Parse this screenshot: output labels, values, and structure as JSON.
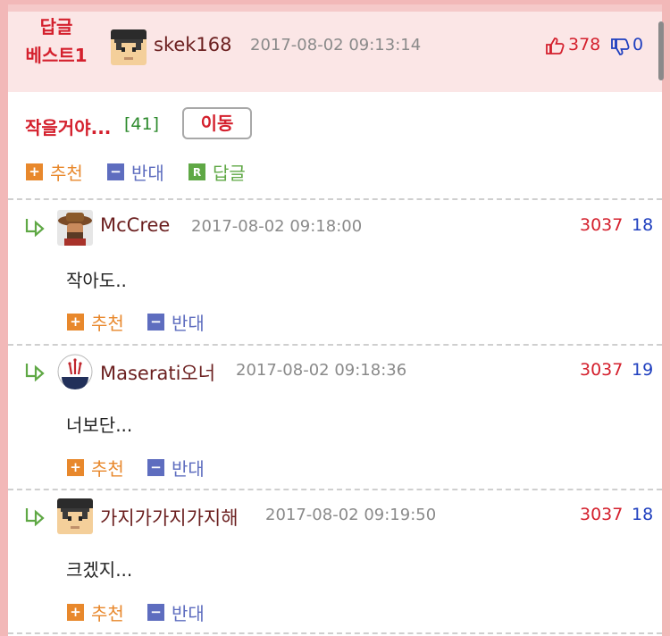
{
  "best_reply": {
    "label_line1": "답글",
    "label_line2": "베스트1",
    "username": "skek168",
    "timestamp": "2017-08-02 09:13:14",
    "upvotes": "378",
    "downvotes": "0",
    "icons": {
      "upvote": "thumbs-up-icon",
      "downvote": "thumbs-down-icon"
    }
  },
  "post": {
    "title": "작을거야...",
    "comment_count": "[41]",
    "move_button": "이동",
    "actions": {
      "recommend": "추천",
      "oppose": "반대",
      "reply": "답글"
    }
  },
  "comments": [
    {
      "username": "McCree",
      "timestamp": "2017-08-02 09:18:00",
      "text": "작아도..",
      "score": "3037",
      "score2": "18",
      "recommend": "추천",
      "oppose": "반대"
    },
    {
      "username": "Maserati오너",
      "timestamp": "2017-08-02 09:18:36",
      "text": "너보단...",
      "score": "3037",
      "score2": "19",
      "recommend": "추천",
      "oppose": "반대"
    },
    {
      "username": "가지가가지가지해",
      "timestamp": "2017-08-02 09:19:50",
      "text": "크겠지...",
      "score": "3037",
      "score2": "18",
      "recommend": "추천",
      "oppose": "반대"
    }
  ],
  "colors": {
    "accent_red": "#d4202d",
    "up_orange": "#e8882c",
    "down_blue": "#5e6dbf",
    "reply_green": "#5fa845",
    "border_pink": "#f2b8b8"
  }
}
